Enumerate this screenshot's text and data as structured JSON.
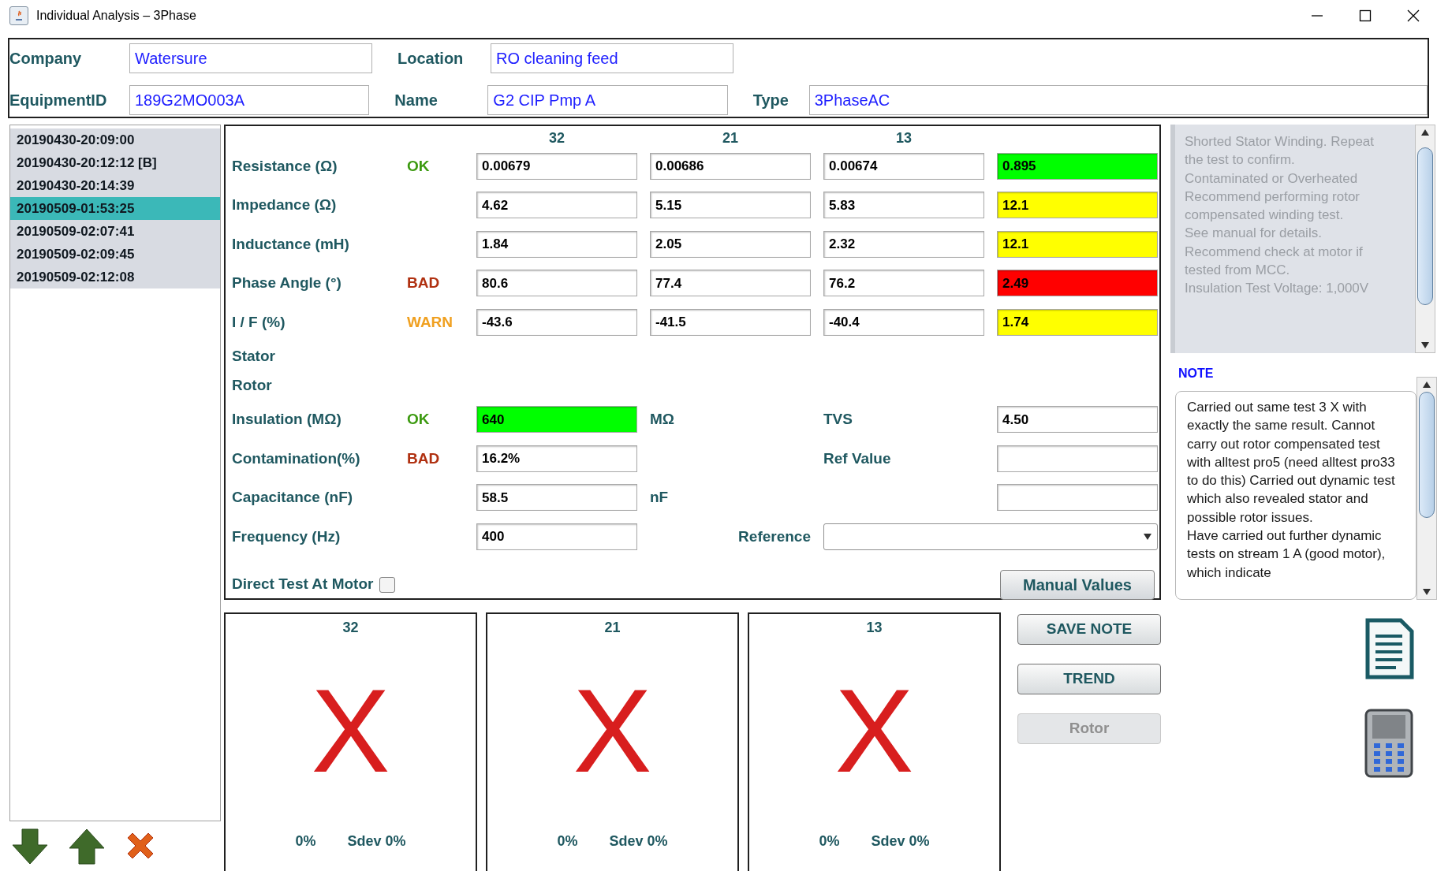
{
  "window": {
    "title": "Individual Analysis – 3Phase"
  },
  "header": {
    "company": {
      "label": "Company",
      "value": "Watersure"
    },
    "location": {
      "label": "Location",
      "value": "RO cleaning feed"
    },
    "equipment_id": {
      "label": "EquipmentID",
      "value": "189G2MO003A"
    },
    "name": {
      "label": "Name",
      "value": "G2 CIP Pmp A"
    },
    "type": {
      "label": "Type",
      "value": "3PhaseAC"
    }
  },
  "tests": [
    {
      "label": "20190430-20:09:00",
      "selected": false
    },
    {
      "label": "20190430-20:12:12 [B]",
      "selected": false
    },
    {
      "label": "20190430-20:14:39",
      "selected": false
    },
    {
      "label": "20190509-01:53:25",
      "selected": true
    },
    {
      "label": "20190509-02:07:41",
      "selected": false
    },
    {
      "label": "20190509-02:09:45",
      "selected": false
    },
    {
      "label": "20190509-02:12:08",
      "selected": false
    }
  ],
  "measurements": {
    "columns": [
      "32",
      "21",
      "13"
    ],
    "rows": [
      {
        "label": "Resistance (Ω)",
        "status": {
          "text": "OK",
          "color": "#3c9a10"
        },
        "values": [
          "0.00679",
          "0.00686",
          "0.00674"
        ],
        "summary": {
          "value": "0.895",
          "color": "#00ff00"
        }
      },
      {
        "label": "Impedance (Ω)",
        "values": [
          "4.62",
          "5.15",
          "5.83"
        ],
        "summary": {
          "value": "12.1",
          "color": "#ffff00"
        }
      },
      {
        "label": "Inductance (mH)",
        "values": [
          "1.84",
          "2.05",
          "2.32"
        ],
        "summary": {
          "value": "12.1",
          "color": "#ffff00"
        }
      },
      {
        "label": "Phase Angle (°)",
        "status": {
          "text": "BAD",
          "color": "#b03010"
        },
        "values": [
          "80.6",
          "77.4",
          "76.2"
        ],
        "summary": {
          "value": "2.49",
          "color": "#ff0000"
        }
      },
      {
        "label": "I / F (%)",
        "status": {
          "text": "WARN",
          "color": "#f0a020"
        },
        "values": [
          "-43.6",
          "-41.5",
          "-40.4"
        ],
        "summary": {
          "value": "1.74",
          "color": "#ffff00"
        }
      }
    ],
    "sections": [
      "Stator",
      "Rotor"
    ],
    "insulation": {
      "label": "Insulation (MΩ)",
      "status": {
        "text": "OK",
        "color": "#3c9a10"
      },
      "value": {
        "value": "640",
        "color": "#00ff00"
      },
      "unit": "MΩ",
      "right_label": "TVS",
      "right_value": "4.50"
    },
    "contamination": {
      "label": "Contamination(%)",
      "status": {
        "text": "BAD",
        "color": "#b03010"
      },
      "value": "16.2%",
      "right_label": "Ref Value"
    },
    "capacitance": {
      "label": "Capacitance (nF)",
      "value": "58.5",
      "unit": "nF"
    },
    "frequency": {
      "label": "Frequency (Hz)",
      "value": "400",
      "right_label": "Reference"
    },
    "direct_test": {
      "label": "Direct Test At Motor",
      "checked": false
    },
    "manual_button": "Manual Values"
  },
  "diagnosis": "Shorted Stator Winding. Repeat\nthe test to confirm.\nContaminated or Overheated\nRecommend performing rotor\ncompensated winding test.\nSee manual for details.\nRecommend check at motor if\ntested from MCC.\nInsulation Test Voltage: 1,000V",
  "note": {
    "label": "NOTE",
    "text": "Carried out same test 3 X with exactly the same result. Cannot carry out rotor compensated test with alltest pro5 (need alltest pro33 to do this) Carried out dynamic test which also revealed stator and possible rotor issues.\nHave carried out further dynamic tests on stream 1 A (good motor), which indicate"
  },
  "phases": [
    {
      "label": "32",
      "result": "X",
      "percent": "0%",
      "sdev": "Sdev 0%"
    },
    {
      "label": "21",
      "result": "X",
      "percent": "0%",
      "sdev": "Sdev 0%"
    },
    {
      "label": "13",
      "result": "X",
      "percent": "0%",
      "sdev": "Sdev 0%"
    }
  ],
  "actions": [
    {
      "label": "SAVE NOTE",
      "disabled": false
    },
    {
      "label": "TREND",
      "disabled": false
    },
    {
      "label": "Rotor",
      "disabled": true
    }
  ]
}
